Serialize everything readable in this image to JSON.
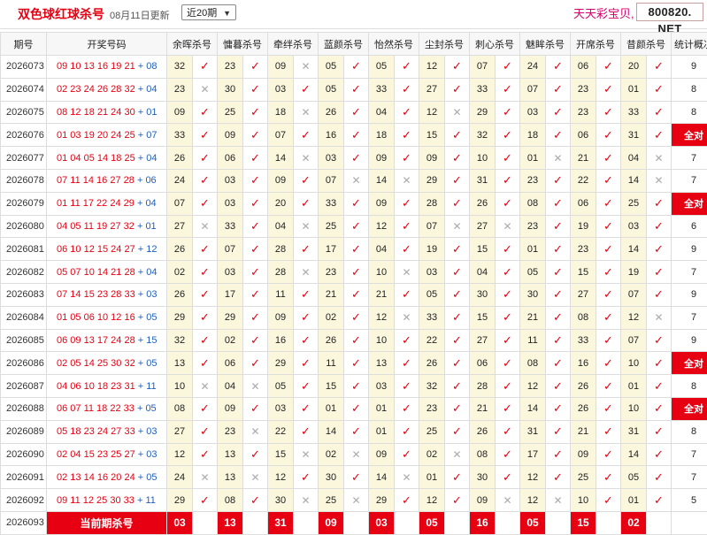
{
  "header": {
    "title": "双色球红球杀号",
    "date": "08月11日更新",
    "period_select": "近20期",
    "brand": "天天彩宝贝,",
    "site": "800820. NET"
  },
  "table": {
    "headers": [
      "期号",
      "开奖号码",
      "余晖杀号",
      "慵暮杀号",
      "牵绊杀号",
      "蓝颜杀号",
      "怡然杀号",
      "尘封杀号",
      "刺心杀号",
      "魅眸杀号",
      "开席杀号",
      "昔颜杀号",
      "统计概况"
    ],
    "rows": [
      {
        "period": "2026073",
        "red": "09 10 13 16 19 21",
        "blue": "08",
        "kills": [
          [
            "32",
            1
          ],
          [
            "23",
            1
          ],
          [
            "09",
            0
          ],
          [
            "05",
            1
          ],
          [
            "05",
            1
          ],
          [
            "12",
            1
          ],
          [
            "07",
            1
          ],
          [
            "24",
            1
          ],
          [
            "06",
            1
          ],
          [
            "20",
            1
          ]
        ],
        "stat": "9"
      },
      {
        "period": "2026074",
        "red": "02 23 24 26 28 32",
        "blue": "04",
        "kills": [
          [
            "23",
            0
          ],
          [
            "30",
            1
          ],
          [
            "03",
            1
          ],
          [
            "05",
            1
          ],
          [
            "33",
            1
          ],
          [
            "27",
            1
          ],
          [
            "33",
            1
          ],
          [
            "07",
            1
          ],
          [
            "23",
            1
          ],
          [
            "01",
            1
          ]
        ],
        "stat": "8"
      },
      {
        "period": "2026075",
        "red": "08 12 18 21 24 30",
        "blue": "01",
        "kills": [
          [
            "09",
            1
          ],
          [
            "25",
            1
          ],
          [
            "18",
            0
          ],
          [
            "26",
            1
          ],
          [
            "04",
            1
          ],
          [
            "12",
            0
          ],
          [
            "29",
            1
          ],
          [
            "03",
            1
          ],
          [
            "23",
            1
          ],
          [
            "33",
            1
          ]
        ],
        "stat": "8"
      },
      {
        "period": "2026076",
        "red": "01 03 19 20 24 25",
        "blue": "07",
        "kills": [
          [
            "33",
            1
          ],
          [
            "09",
            1
          ],
          [
            "07",
            1
          ],
          [
            "16",
            1
          ],
          [
            "18",
            1
          ],
          [
            "15",
            1
          ],
          [
            "32",
            1
          ],
          [
            "18",
            1
          ],
          [
            "06",
            1
          ],
          [
            "31",
            1
          ]
        ],
        "stat": "全对"
      },
      {
        "period": "2026077",
        "red": "01 04 05 14 18 25",
        "blue": "04",
        "kills": [
          [
            "26",
            1
          ],
          [
            "06",
            1
          ],
          [
            "14",
            0
          ],
          [
            "03",
            1
          ],
          [
            "09",
            1
          ],
          [
            "09",
            1
          ],
          [
            "10",
            1
          ],
          [
            "01",
            0
          ],
          [
            "21",
            1
          ],
          [
            "04",
            0
          ]
        ],
        "stat": "7"
      },
      {
        "period": "2026078",
        "red": "07 11 14 16 27 28",
        "blue": "06",
        "kills": [
          [
            "24",
            1
          ],
          [
            "03",
            1
          ],
          [
            "09",
            1
          ],
          [
            "07",
            0
          ],
          [
            "14",
            0
          ],
          [
            "29",
            1
          ],
          [
            "31",
            1
          ],
          [
            "23",
            1
          ],
          [
            "22",
            1
          ],
          [
            "14",
            0
          ]
        ],
        "stat": "7"
      },
      {
        "period": "2026079",
        "red": "01 11 17 22 24 29",
        "blue": "04",
        "kills": [
          [
            "07",
            1
          ],
          [
            "03",
            1
          ],
          [
            "20",
            1
          ],
          [
            "33",
            1
          ],
          [
            "09",
            1
          ],
          [
            "28",
            1
          ],
          [
            "26",
            1
          ],
          [
            "08",
            1
          ],
          [
            "06",
            1
          ],
          [
            "25",
            1
          ]
        ],
        "stat": "全对"
      },
      {
        "period": "2026080",
        "red": "04 05 11 19 27 32",
        "blue": "01",
        "kills": [
          [
            "27",
            0
          ],
          [
            "33",
            1
          ],
          [
            "04",
            0
          ],
          [
            "25",
            1
          ],
          [
            "12",
            1
          ],
          [
            "07",
            0
          ],
          [
            "27",
            0
          ],
          [
            "23",
            1
          ],
          [
            "19",
            1
          ],
          [
            "03",
            1
          ]
        ],
        "stat": "6"
      },
      {
        "period": "2026081",
        "red": "06 10 12 15 24 27",
        "blue": "12",
        "kills": [
          [
            "26",
            1
          ],
          [
            "07",
            1
          ],
          [
            "28",
            1
          ],
          [
            "17",
            1
          ],
          [
            "04",
            1
          ],
          [
            "19",
            1
          ],
          [
            "15",
            1
          ],
          [
            "01",
            1
          ],
          [
            "23",
            1
          ],
          [
            "14",
            1
          ]
        ],
        "stat": "9"
      },
      {
        "period": "2026082",
        "red": "05 07 10 14 21 28",
        "blue": "04",
        "kills": [
          [
            "02",
            1
          ],
          [
            "03",
            1
          ],
          [
            "28",
            0
          ],
          [
            "23",
            1
          ],
          [
            "10",
            0
          ],
          [
            "03",
            1
          ],
          [
            "04",
            1
          ],
          [
            "05",
            1
          ],
          [
            "15",
            1
          ],
          [
            "19",
            1
          ]
        ],
        "stat": "7"
      },
      {
        "period": "2026083",
        "red": "07 14 15 23 28 33",
        "blue": "03",
        "kills": [
          [
            "26",
            1
          ],
          [
            "17",
            1
          ],
          [
            "11",
            1
          ],
          [
            "21",
            1
          ],
          [
            "21",
            1
          ],
          [
            "05",
            1
          ],
          [
            "30",
            1
          ],
          [
            "30",
            1
          ],
          [
            "27",
            1
          ],
          [
            "07",
            1
          ]
        ],
        "stat": "9"
      },
      {
        "period": "2026084",
        "red": "01 05 06 10 12 16",
        "blue": "05",
        "kills": [
          [
            "29",
            1
          ],
          [
            "29",
            1
          ],
          [
            "09",
            1
          ],
          [
            "02",
            1
          ],
          [
            "12",
            0
          ],
          [
            "33",
            1
          ],
          [
            "15",
            1
          ],
          [
            "21",
            1
          ],
          [
            "08",
            1
          ],
          [
            "12",
            0
          ]
        ],
        "stat": "7"
      },
      {
        "period": "2026085",
        "red": "06 09 13 17 24 28",
        "blue": "15",
        "kills": [
          [
            "32",
            1
          ],
          [
            "02",
            1
          ],
          [
            "16",
            1
          ],
          [
            "26",
            1
          ],
          [
            "10",
            1
          ],
          [
            "22",
            1
          ],
          [
            "27",
            1
          ],
          [
            "11",
            1
          ],
          [
            "33",
            1
          ],
          [
            "07",
            1
          ]
        ],
        "stat": "9"
      },
      {
        "period": "2026086",
        "red": "02 05 14 25 30 32",
        "blue": "05",
        "kills": [
          [
            "13",
            1
          ],
          [
            "06",
            1
          ],
          [
            "29",
            1
          ],
          [
            "11",
            1
          ],
          [
            "13",
            1
          ],
          [
            "26",
            1
          ],
          [
            "06",
            1
          ],
          [
            "08",
            1
          ],
          [
            "16",
            1
          ],
          [
            "10",
            1
          ]
        ],
        "stat": "全对"
      },
      {
        "period": "2026087",
        "red": "04 06 10 18 23 31",
        "blue": "11",
        "kills": [
          [
            "10",
            0
          ],
          [
            "04",
            0
          ],
          [
            "05",
            1
          ],
          [
            "15",
            1
          ],
          [
            "03",
            1
          ],
          [
            "32",
            1
          ],
          [
            "28",
            1
          ],
          [
            "12",
            1
          ],
          [
            "26",
            1
          ],
          [
            "01",
            1
          ]
        ],
        "stat": "8"
      },
      {
        "period": "2026088",
        "red": "06 07 11 18 22 33",
        "blue": "05",
        "kills": [
          [
            "08",
            1
          ],
          [
            "09",
            1
          ],
          [
            "03",
            1
          ],
          [
            "01",
            1
          ],
          [
            "01",
            1
          ],
          [
            "23",
            1
          ],
          [
            "21",
            1
          ],
          [
            "14",
            1
          ],
          [
            "26",
            1
          ],
          [
            "10",
            1
          ]
        ],
        "stat": "全对"
      },
      {
        "period": "2026089",
        "red": "05 18 23 24 27 33",
        "blue": "03",
        "kills": [
          [
            "27",
            1
          ],
          [
            "23",
            0
          ],
          [
            "22",
            1
          ],
          [
            "14",
            1
          ],
          [
            "01",
            1
          ],
          [
            "25",
            1
          ],
          [
            "26",
            1
          ],
          [
            "31",
            1
          ],
          [
            "21",
            1
          ],
          [
            "31",
            1
          ]
        ],
        "stat": "8"
      },
      {
        "period": "2026090",
        "red": "02 04 15 23 25 27",
        "blue": "03",
        "kills": [
          [
            "12",
            1
          ],
          [
            "13",
            1
          ],
          [
            "15",
            0
          ],
          [
            "02",
            0
          ],
          [
            "09",
            1
          ],
          [
            "02",
            0
          ],
          [
            "08",
            1
          ],
          [
            "17",
            1
          ],
          [
            "09",
            1
          ],
          [
            "14",
            1
          ]
        ],
        "stat": "7"
      },
      {
        "period": "2026091",
        "red": "02 13 14 16 20 24",
        "blue": "05",
        "kills": [
          [
            "24",
            0
          ],
          [
            "13",
            0
          ],
          [
            "12",
            1
          ],
          [
            "30",
            1
          ],
          [
            "14",
            0
          ],
          [
            "01",
            1
          ],
          [
            "30",
            1
          ],
          [
            "12",
            1
          ],
          [
            "25",
            1
          ],
          [
            "05",
            1
          ]
        ],
        "stat": "7"
      },
      {
        "period": "2026092",
        "red": "09 11 12 25 30 33",
        "blue": "11",
        "kills": [
          [
            "29",
            1
          ],
          [
            "08",
            1
          ],
          [
            "30",
            0
          ],
          [
            "25",
            0
          ],
          [
            "29",
            1
          ],
          [
            "12",
            1
          ],
          [
            "09",
            0
          ],
          [
            "12",
            0
          ],
          [
            "10",
            1
          ],
          [
            "01",
            1
          ]
        ],
        "stat": "5"
      }
    ],
    "current": {
      "period": "2026093",
      "label": "当前期杀号",
      "kills": [
        "03",
        "13",
        "31",
        "09",
        "03",
        "05",
        "16",
        "05",
        "15",
        "02"
      ]
    }
  },
  "icons": {
    "ok": "check-mark-icon",
    "no": "cross-mark-icon"
  },
  "colors": {
    "accent": "#e60012",
    "blue_ball": "#1f5fbf",
    "highlight": "#fbf7dd"
  }
}
